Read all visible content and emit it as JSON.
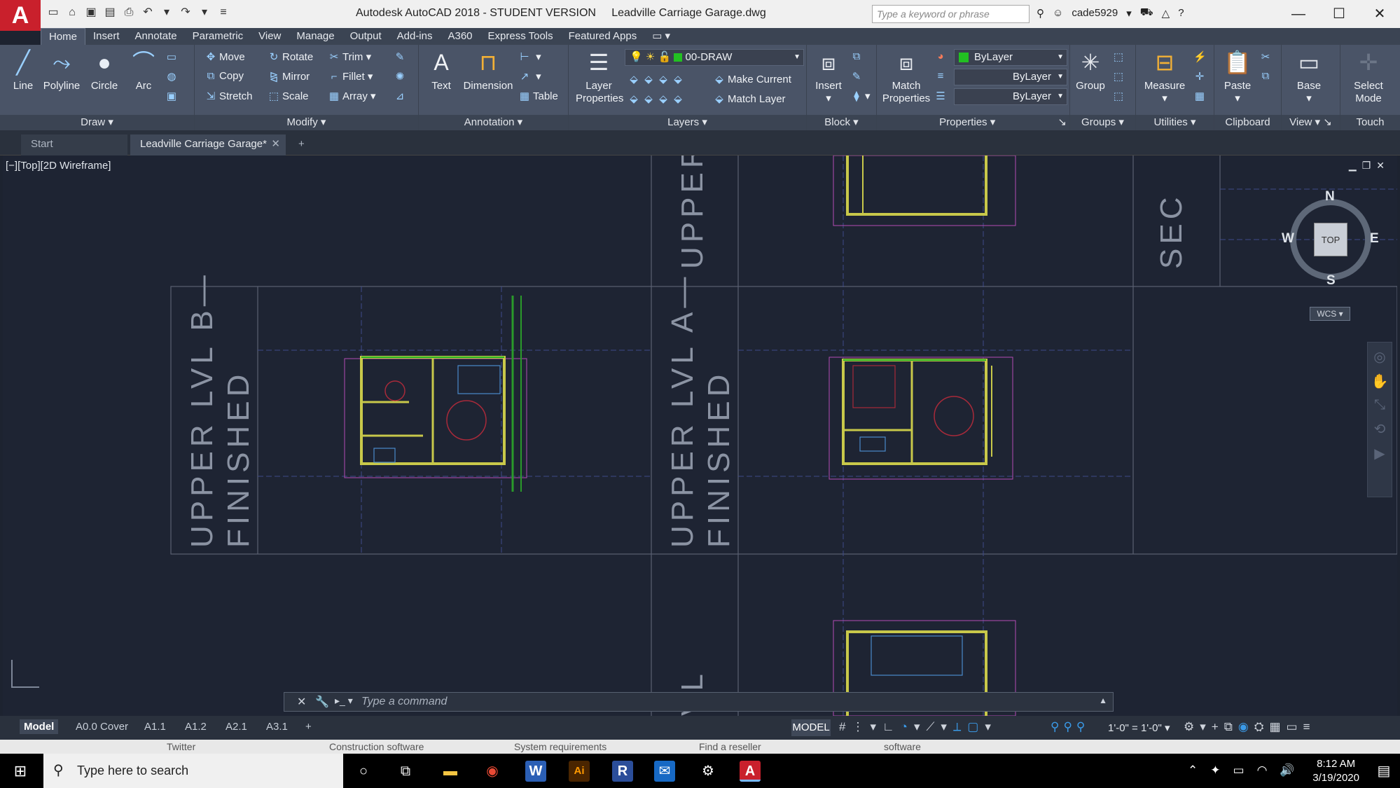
{
  "title_bar": {
    "app_logo": "A",
    "title_app": "Autodesk AutoCAD 2018 - STUDENT VERSION",
    "title_doc": "Leadville Carriage Garage.dwg",
    "search_placeholder": "Type a keyword or phrase",
    "username": "cade5929"
  },
  "ribbon_tabs": [
    "Home",
    "Insert",
    "Annotate",
    "Parametric",
    "View",
    "Manage",
    "Output",
    "Add-ins",
    "A360",
    "Express Tools",
    "Featured Apps"
  ],
  "panels": {
    "draw": {
      "label": "Draw",
      "line": "Line",
      "polyline": "Polyline",
      "circle": "Circle",
      "arc": "Arc"
    },
    "modify": {
      "label": "Modify",
      "move": "Move",
      "rotate": "Rotate",
      "trim": "Trim",
      "copy": "Copy",
      "mirror": "Mirror",
      "fillet": "Fillet",
      "stretch": "Stretch",
      "scale": "Scale",
      "array": "Array"
    },
    "annotation": {
      "label": "Annotation",
      "text": "Text",
      "dimension": "Dimension",
      "table": "Table"
    },
    "layers": {
      "label": "Layers",
      "layer_properties": "Layer Properties",
      "current_layer": "00-DRAW",
      "make_current": "Make Current",
      "match_layer": "Match Layer"
    },
    "block": {
      "label": "Block",
      "insert": "Insert"
    },
    "properties": {
      "label": "Properties",
      "match_properties": "Match Properties",
      "color": "ByLayer",
      "linetype": "ByLayer",
      "lineweight": "ByLayer"
    },
    "groups": {
      "label": "Groups",
      "group": "Group"
    },
    "utilities": {
      "label": "Utilities",
      "measure": "Measure"
    },
    "clipboard": {
      "label": "Clipboard",
      "paste": "Paste"
    },
    "view": {
      "label": "View",
      "base": "Base"
    },
    "touch": {
      "label": "Touch",
      "select_mode": "Select Mode"
    }
  },
  "doc_tabs": {
    "start": "Start",
    "active": "Leadville Carriage Garage*"
  },
  "viewport": {
    "label": "[−][Top][2D Wireframe]",
    "viewcube": {
      "n": "N",
      "s": "S",
      "e": "E",
      "w": "W",
      "face": "TOP",
      "wcs": "WCS"
    },
    "sheet_titles": [
      "UPPER LVL B—",
      "FINISHED",
      "UPPER LVL A—",
      "FINISHED",
      "UPPER",
      "SEC",
      "VL"
    ]
  },
  "command_line": {
    "placeholder": "Type a command"
  },
  "layout_tabs": [
    "Model",
    "A0.0 Cover",
    "A1.1",
    "A1.2",
    "A2.1",
    "A3.1"
  ],
  "status": {
    "model": "MODEL",
    "scale": "1'-0\" = 1'-0\""
  },
  "below_strip": [
    "Twitter",
    "Construction software",
    "System requirements",
    "Find a reseller",
    "software"
  ],
  "taskbar": {
    "search": "Type here to search",
    "time": "8:12 AM",
    "date": "3/19/2020"
  }
}
